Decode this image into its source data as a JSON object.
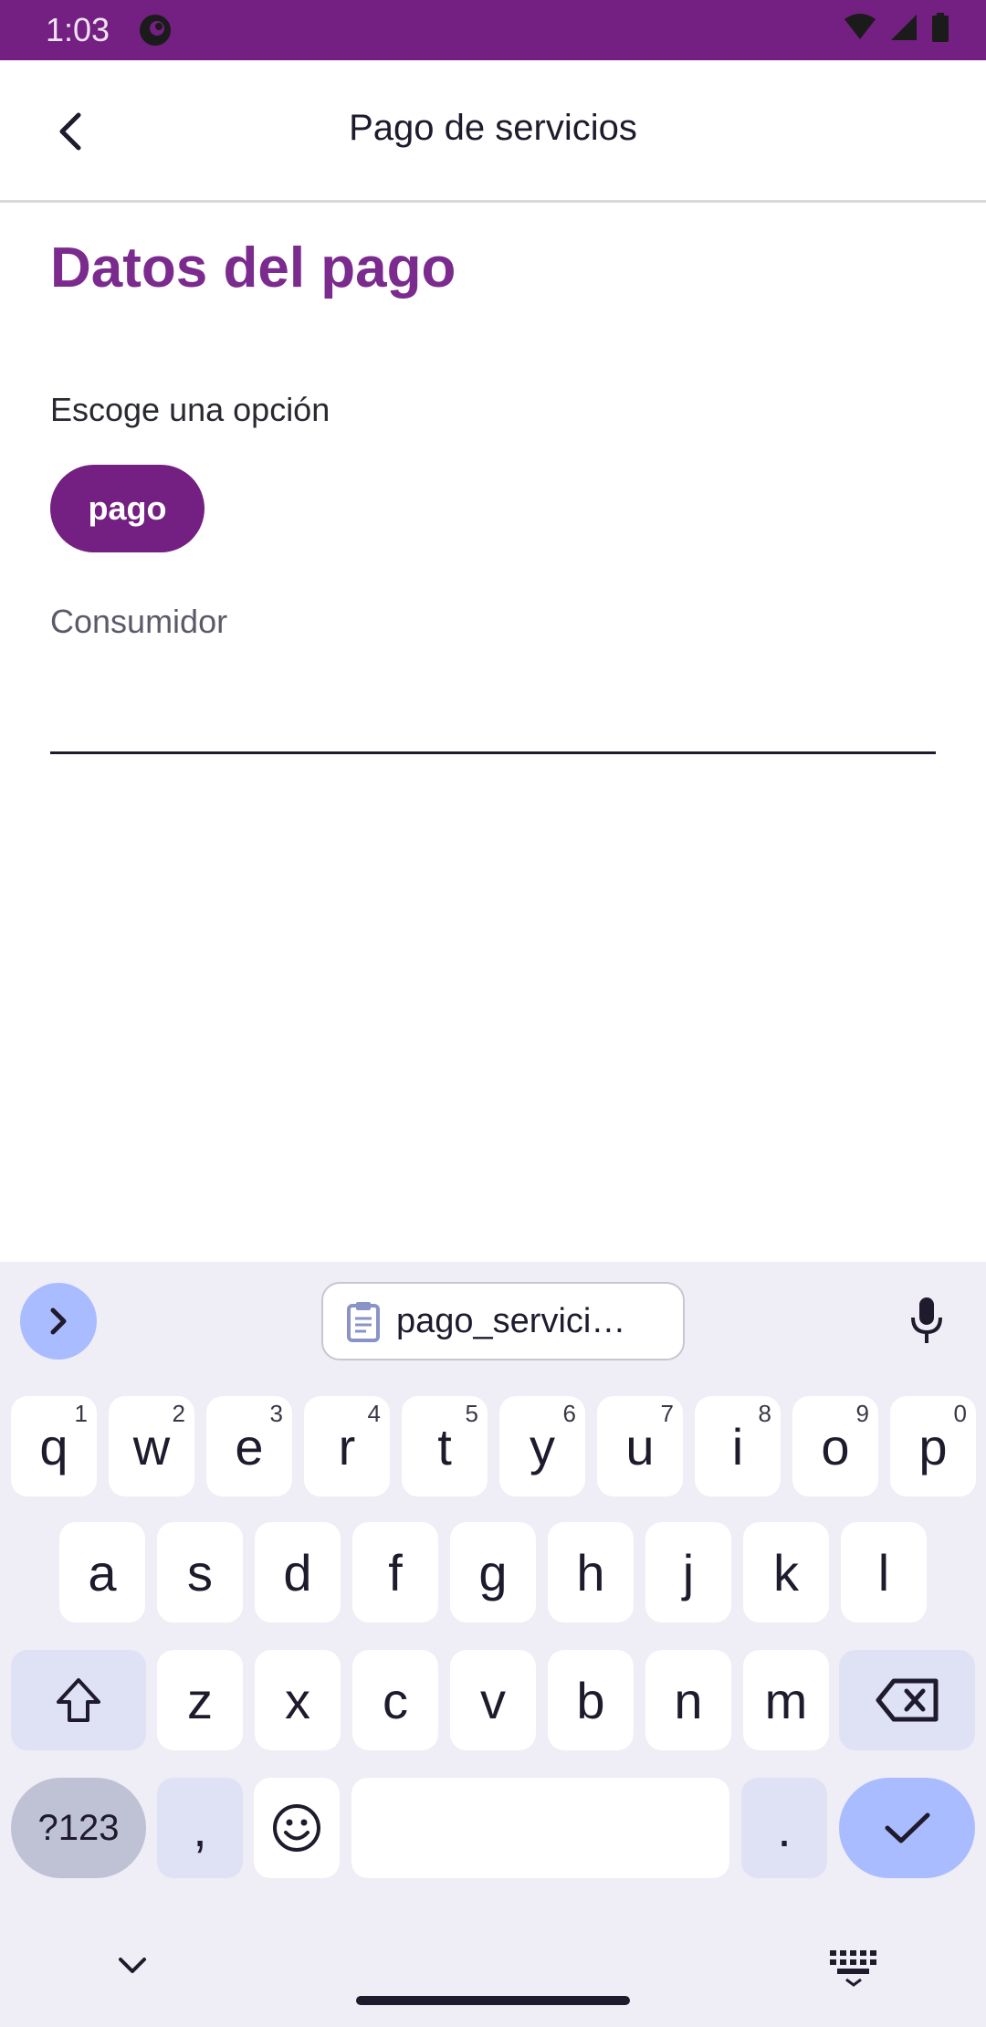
{
  "status_bar": {
    "time": "1:03",
    "colors": {
      "background": "#741f82"
    },
    "icons": [
      "app-icon",
      "wifi-icon",
      "signal-icon",
      "battery-icon"
    ]
  },
  "app_bar": {
    "title": "Pago de servicios",
    "back_icon": "chevron-left-icon"
  },
  "form": {
    "section_title": "Datos del pago",
    "option_label": "Escoge una opción",
    "chip_label": "pago",
    "field_label": "Consumidor",
    "field_value": ""
  },
  "keyboard": {
    "clipboard_text": "pago_servici…",
    "rows": [
      {
        "keys": [
          {
            "label": "q",
            "hint": "1"
          },
          {
            "label": "w",
            "hint": "2"
          },
          {
            "label": "e",
            "hint": "3"
          },
          {
            "label": "r",
            "hint": "4"
          },
          {
            "label": "t",
            "hint": "5"
          },
          {
            "label": "y",
            "hint": "6"
          },
          {
            "label": "u",
            "hint": "7"
          },
          {
            "label": "i",
            "hint": "8"
          },
          {
            "label": "o",
            "hint": "9"
          },
          {
            "label": "p",
            "hint": "0"
          }
        ]
      },
      {
        "keys": [
          {
            "label": "a"
          },
          {
            "label": "s"
          },
          {
            "label": "d"
          },
          {
            "label": "f"
          },
          {
            "label": "g"
          },
          {
            "label": "h"
          },
          {
            "label": "j"
          },
          {
            "label": "k"
          },
          {
            "label": "l"
          }
        ]
      },
      {
        "keys": [
          {
            "label": "z"
          },
          {
            "label": "x"
          },
          {
            "label": "c"
          },
          {
            "label": "v"
          },
          {
            "label": "b"
          },
          {
            "label": "n"
          },
          {
            "label": "m"
          }
        ]
      }
    ],
    "symbols_label": "?123",
    "comma_label": ",",
    "period_label": ".",
    "accent_color": "#a9bcff"
  },
  "colors": {
    "primary": "#741f82",
    "heading": "#7b2a8e"
  }
}
